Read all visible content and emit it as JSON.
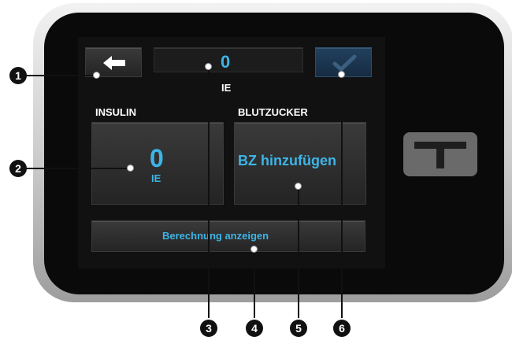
{
  "screen": {
    "total_value": "0",
    "total_unit": "IE",
    "insulin_heading": "INSULIN",
    "insulin_value": "0",
    "insulin_unit": "IE",
    "bg_heading": "BLUTZUCKER",
    "bg_button_label": "BZ hinzufügen",
    "calc_button_label": "Berechnung anzeigen"
  },
  "callouts": [
    "1",
    "2",
    "3",
    "4",
    "5",
    "6"
  ],
  "icons": {
    "back": "arrow-left-icon",
    "confirm": "checkmark-icon",
    "logo": "t-logo-icon"
  },
  "colors": {
    "accent": "#3db5e6",
    "confirm_bg": "#22405e",
    "screen_bg": "#111111"
  }
}
